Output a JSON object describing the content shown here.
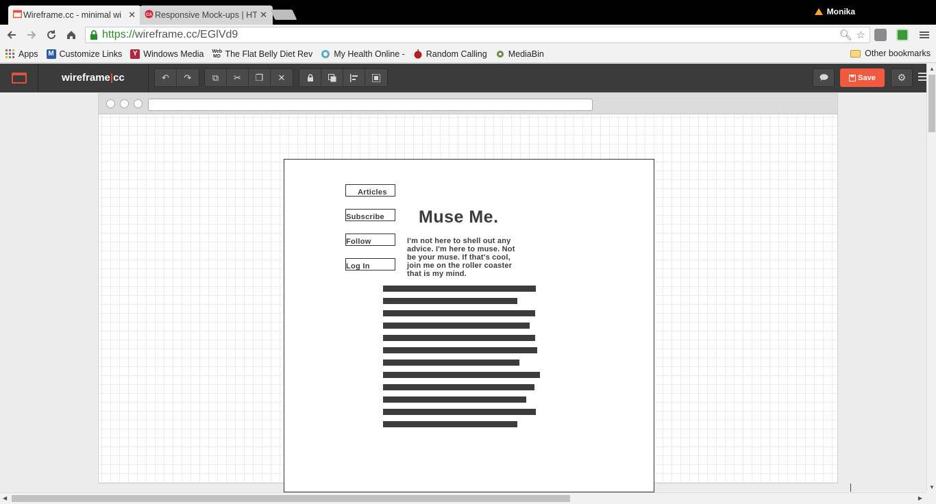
{
  "browser": {
    "tabs": [
      {
        "title": "Wireframe.cc - minimal wi",
        "favicon": "wireframe-icon",
        "color": "#e0533a"
      },
      {
        "title": "Responsive Mock-ups | HT",
        "favicon": "ca-icon",
        "color": "#d0283d"
      }
    ],
    "profile_name": "Monika",
    "url_scheme": "https://",
    "url_rest": "wireframe.cc/EGlVd9"
  },
  "bookmarks": {
    "items": [
      {
        "label": "Apps",
        "icon": "apps-grid-icon"
      },
      {
        "label": "Customize Links",
        "icon": "m-icon"
      },
      {
        "label": "Windows Media",
        "icon": "y-icon"
      },
      {
        "label": "The Flat Belly Diet Rev",
        "icon": "webmd-icon"
      },
      {
        "label": "My Health Online -",
        "icon": "health-icon"
      },
      {
        "label": "Random Calling",
        "icon": "apple-icon"
      },
      {
        "label": "MediaBin",
        "icon": "gear-icon"
      }
    ],
    "other": "Other bookmarks"
  },
  "app": {
    "brand_left": "wireframe",
    "brand_right": "cc",
    "save_label": "Save",
    "accent": "#f25a3f"
  },
  "wireframe": {
    "nav": [
      "Articles",
      "Subscribe",
      "Follow",
      "Log In"
    ],
    "title": "Muse Me.",
    "text": "I'm not here to shell out any advice. I'm here to muse. Not be your muse. If that's cool, join me on the roller coaster that is my mind.",
    "text_lines": [
      "I'm not here to shell out any",
      "advice. I'm here to muse. Not",
      "be your muse. If that's cool,",
      "join me on the roller coaster",
      "that is my mind."
    ]
  }
}
